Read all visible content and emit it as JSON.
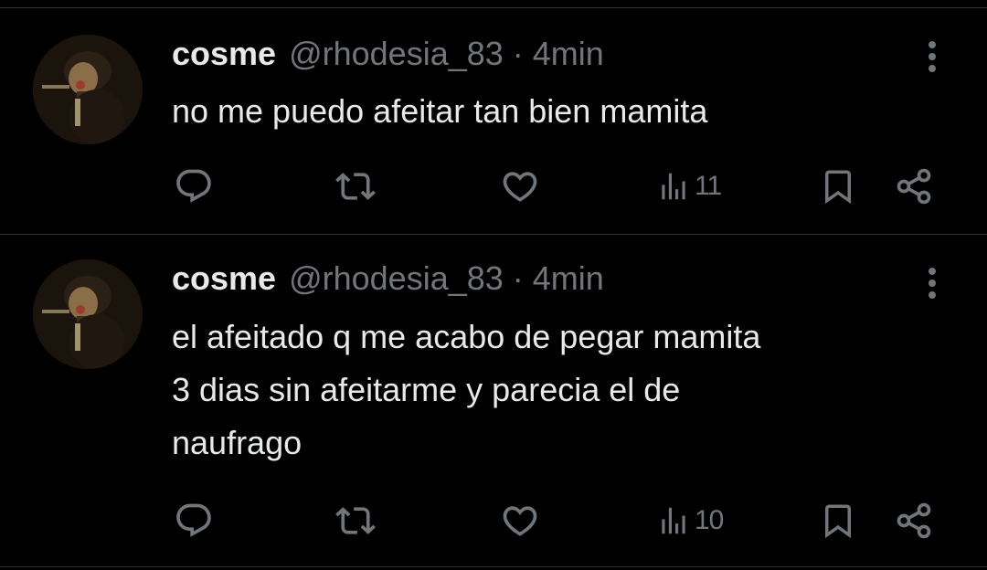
{
  "colors": {
    "background": "#000000",
    "text_primary": "#e7e9ea",
    "text_secondary": "#71767b",
    "divider": "#2f3336"
  },
  "tweets": [
    {
      "name": "cosme",
      "handle": "@rhodesia_83",
      "separator": "·",
      "time": "4min",
      "lines": [
        "no me puedo afeitar tan bien mamita"
      ],
      "views": "11",
      "icons": [
        "reply-icon",
        "retweet-icon",
        "like-icon",
        "views-icon",
        "bookmark-icon",
        "share-icon",
        "more-icon"
      ]
    },
    {
      "name": "cosme",
      "handle": "@rhodesia_83",
      "separator": "·",
      "time": "4min",
      "lines": [
        "el afeitado q me acabo de pegar mamita",
        "3 dias sin afeitarme y parecia el de",
        "naufrago"
      ],
      "views": "10",
      "icons": [
        "reply-icon",
        "retweet-icon",
        "like-icon",
        "views-icon",
        "bookmark-icon",
        "share-icon",
        "more-icon"
      ]
    }
  ]
}
